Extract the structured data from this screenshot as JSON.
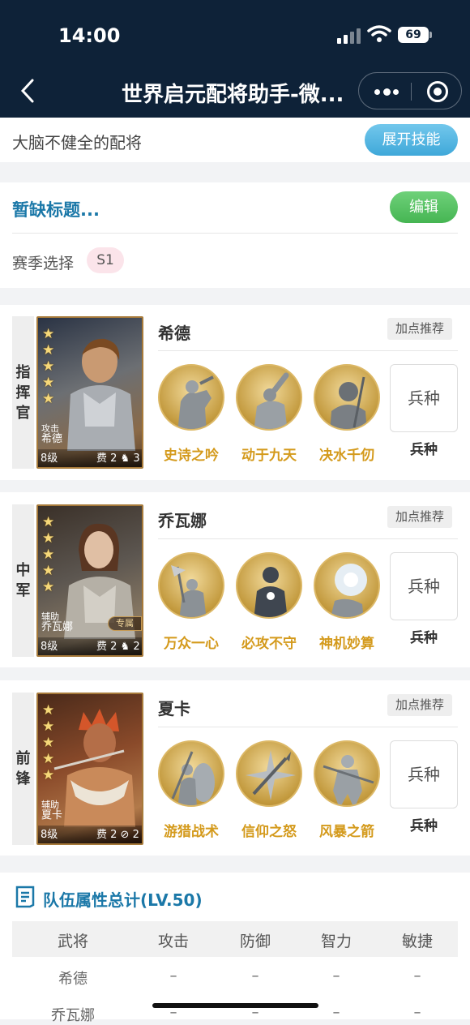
{
  "status_bar": {
    "time": "14:00",
    "battery": "69"
  },
  "nav": {
    "title": "世界启元配将助手-微..."
  },
  "header": {
    "subtitle": "大脑不健全的配将",
    "expand_button": "展开技能"
  },
  "plan": {
    "title": "暂缺标题...",
    "edit_button": "编辑",
    "season_label": "赛季选择",
    "season_value": "S1"
  },
  "generals": [
    {
      "role": "指挥官",
      "name": "希德",
      "type": "攻击",
      "level": "8级",
      "cost": "费 2",
      "troop_count": "3",
      "tip": "加点推荐",
      "skills": [
        "史诗之吟",
        "动于九天",
        "决水千仞"
      ],
      "troop_box": "兵种",
      "troop_label": "兵种",
      "exclusive": ""
    },
    {
      "role": "中军",
      "name": "乔瓦娜",
      "type": "辅助",
      "level": "8级",
      "cost": "费 2",
      "troop_count": "2",
      "tip": "加点推荐",
      "skills": [
        "万众一心",
        "必攻不守",
        "神机妙算"
      ],
      "troop_box": "兵种",
      "troop_label": "兵种",
      "exclusive": "专属"
    },
    {
      "role": "前锋",
      "name": "夏卡",
      "type": "辅助",
      "level": "8级",
      "cost": "费 2",
      "troop_count": "2",
      "tip": "加点推荐",
      "skills": [
        "游猎战术",
        "信仰之怒",
        "风暴之箭"
      ],
      "troop_box": "兵种",
      "troop_label": "兵种",
      "exclusive": ""
    }
  ],
  "stats": {
    "title": "队伍属性总计(LV.50)",
    "headers": [
      "武将",
      "攻击",
      "防御",
      "智力",
      "敏捷"
    ],
    "rows": [
      [
        "希德",
        "–",
        "–",
        "–",
        "–"
      ],
      [
        "乔瓦娜",
        "–",
        "–",
        "–",
        "–"
      ]
    ]
  },
  "colors": {
    "nav_bg": "#0e2238",
    "accent_blue": "#1b78a8",
    "skill_gold": "#d49a1c",
    "edit_green": "#45b552",
    "expand_blue": "#3fa8d9"
  }
}
